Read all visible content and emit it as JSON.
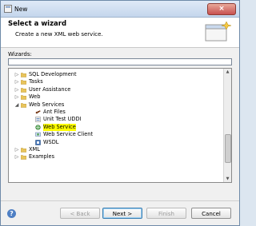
{
  "window": {
    "title": "New",
    "close_glyph": "×"
  },
  "banner": {
    "title": "Select a wizard",
    "description": "Create a new XML web service."
  },
  "filter": {
    "label": "Wizards:",
    "value": ""
  },
  "tree": [
    {
      "label": "SQL Development",
      "type": "folder",
      "expanded": false,
      "level": 0
    },
    {
      "label": "Tasks",
      "type": "folder",
      "expanded": false,
      "level": 0
    },
    {
      "label": "User Assistance",
      "type": "folder",
      "expanded": false,
      "level": 0
    },
    {
      "label": "Web",
      "type": "folder",
      "expanded": false,
      "level": 0
    },
    {
      "label": "Web Services",
      "type": "folder",
      "expanded": true,
      "level": 0
    },
    {
      "label": "Ant Files",
      "type": "ant-file",
      "level": 1
    },
    {
      "label": "Unit Test UDDI",
      "type": "uddi",
      "level": 1
    },
    {
      "label": "Web Service",
      "type": "web-service",
      "level": 1,
      "highlighted": true
    },
    {
      "label": "Web Service Client",
      "type": "web-service-client",
      "level": 1
    },
    {
      "label": "WSDL",
      "type": "wsdl",
      "level": 1
    },
    {
      "label": "XML",
      "type": "folder",
      "expanded": false,
      "level": 0
    },
    {
      "label": "Examples",
      "type": "folder",
      "expanded": false,
      "level": 0
    }
  ],
  "toggle_glyphs": {
    "collapsed": "▷",
    "expanded": "◢"
  },
  "buttons": {
    "help": "?",
    "back": "< Back",
    "next": "Next >",
    "finish": "Finish",
    "cancel": "Cancel"
  },
  "colors": {
    "highlight": "#ffff00",
    "folder": "#e8c45c",
    "default_button": "#3c7fb1"
  }
}
